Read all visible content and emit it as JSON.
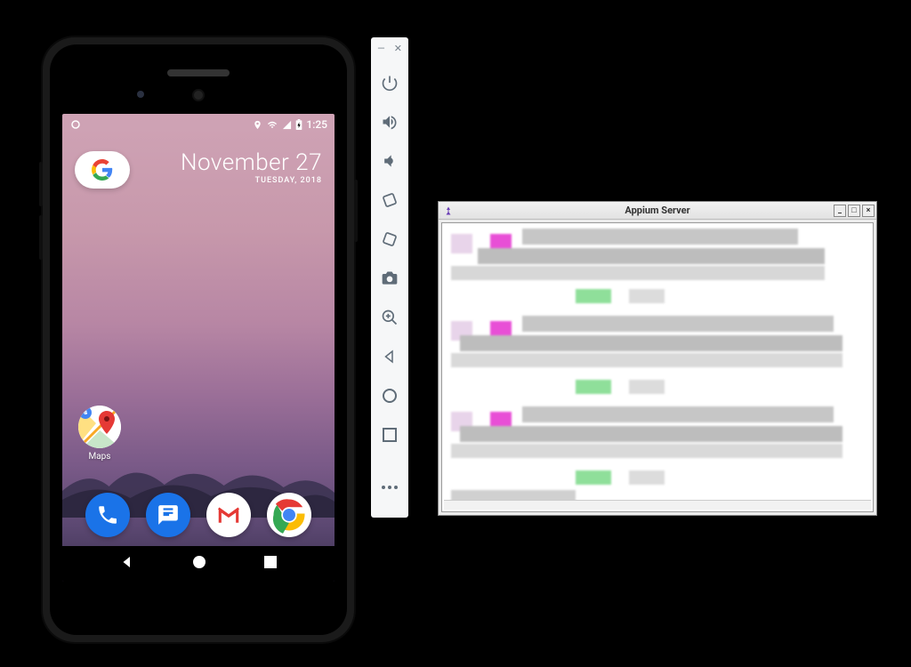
{
  "phone": {
    "status": {
      "time": "1:25",
      "icons": [
        "location",
        "wifi",
        "cell",
        "battery"
      ]
    },
    "date_widget": {
      "date": "November 27",
      "day": "TUESDAY, 2018"
    },
    "google_pill": {
      "name": "google-search"
    },
    "home_apps": [
      {
        "label": "Maps",
        "icon": "maps"
      }
    ],
    "dock": [
      {
        "name": "phone",
        "color": "blue"
      },
      {
        "name": "messages",
        "color": "blue"
      },
      {
        "name": "gmail",
        "color": "white"
      },
      {
        "name": "chrome",
        "color": "white"
      }
    ],
    "navbar": [
      "back",
      "home",
      "overview"
    ]
  },
  "emulator_toolbar": {
    "window_controls": [
      "minimize",
      "close"
    ],
    "buttons": [
      "power",
      "volume-up",
      "volume-down",
      "rotate-left",
      "rotate-right",
      "screenshot",
      "zoom",
      "back",
      "home",
      "overview",
      "more"
    ]
  },
  "appium_window": {
    "title": "Appium Server",
    "controls": [
      "minimize",
      "maximize",
      "close"
    ]
  }
}
